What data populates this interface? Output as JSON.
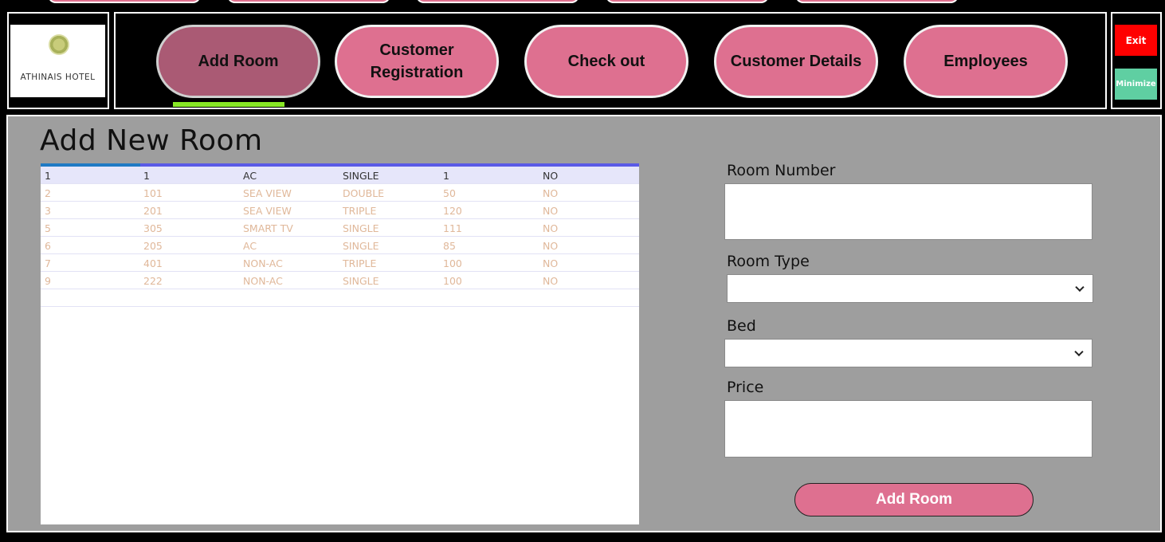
{
  "logo": {
    "text": "ATHINAIS HOTEL"
  },
  "nav": {
    "items": [
      {
        "label": "Add Room"
      },
      {
        "label": "Customer Registration"
      },
      {
        "label": "Check out"
      },
      {
        "label": "Customer Details"
      },
      {
        "label": "Employees"
      }
    ]
  },
  "window": {
    "exit_label": "Exit",
    "minimize_label": "Minimize"
  },
  "page": {
    "title": "Add New Room"
  },
  "grid": {
    "rows": [
      [
        "1",
        "1",
        "AC",
        "SINGLE",
        "1",
        "NO"
      ],
      [
        "2",
        "101",
        "SEA VIEW",
        "DOUBLE",
        "50",
        "NO"
      ],
      [
        "3",
        "201",
        "SEA VIEW",
        "TRIPLE",
        "120",
        "NO"
      ],
      [
        "5",
        "305",
        "SMART TV",
        "SINGLE",
        "111",
        "NO"
      ],
      [
        "6",
        "205",
        "AC",
        "SINGLE",
        "85",
        "NO"
      ],
      [
        "7",
        "401",
        "NON-AC",
        "TRIPLE",
        "100",
        "NO"
      ],
      [
        "9",
        "222",
        "NON-AC",
        "SINGLE",
        "100",
        "NO"
      ]
    ]
  },
  "form": {
    "room_number_label": "Room Number",
    "room_number_value": "",
    "room_type_label": "Room Type",
    "room_type_value": "",
    "bed_label": "Bed",
    "bed_value": "",
    "price_label": "Price",
    "price_value": "",
    "submit_label": "Add Room"
  },
  "colors": {
    "nav_button": "#de7090",
    "nav_button_active": "#aa5a74",
    "nav_underline": "#88e826",
    "exit": "#ff0000",
    "minimize": "#5fcfa2",
    "main_bg": "#9e9e9e"
  }
}
